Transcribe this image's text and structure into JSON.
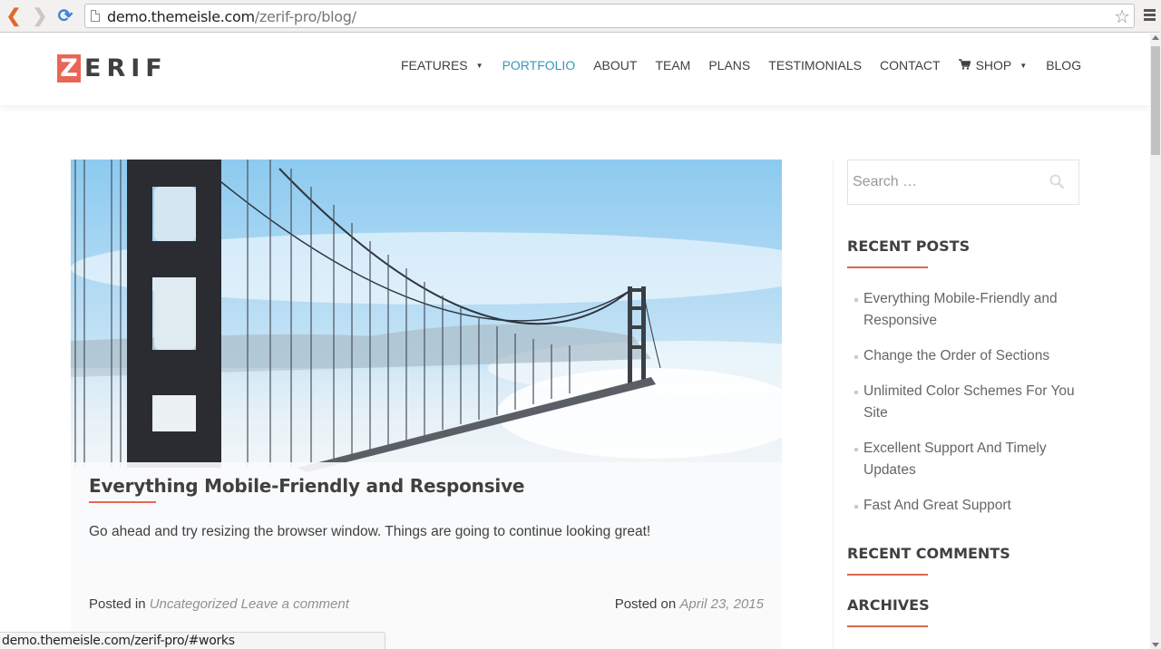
{
  "browser": {
    "url_domain": "demo.themeisle.com",
    "url_path": "/zerif-pro/blog/",
    "status_url": "demo.themeisle.com/zerif-pro/#works"
  },
  "site": {
    "logo_initial": "Z",
    "logo_rest": "ERIF",
    "accent_color": "#e96656",
    "active_nav_color": "#3498b8"
  },
  "nav": {
    "items": [
      {
        "label": "FEATURES",
        "has_dropdown": true
      },
      {
        "label": "PORTFOLIO",
        "active": true
      },
      {
        "label": "ABOUT"
      },
      {
        "label": "TEAM"
      },
      {
        "label": "PLANS"
      },
      {
        "label": "TESTIMONIALS"
      },
      {
        "label": "CONTACT"
      },
      {
        "label": "SHOP",
        "has_dropdown": true,
        "icon": "cart-icon"
      },
      {
        "label": "BLOG"
      }
    ]
  },
  "post": {
    "title": "Everything Mobile-Friendly and Responsive",
    "excerpt": "Go ahead and try resizing the browser window. Things are going to continue looking great!",
    "posted_in_label": "Posted in",
    "category": "Uncategorized",
    "comment_link": "Leave a comment",
    "posted_on_label": "Posted on",
    "date": "April 23, 2015",
    "image_alt": "Golden Gate Bridge in fog"
  },
  "sidebar": {
    "search_placeholder": "Search …",
    "recent_posts_title": "RECENT POSTS",
    "recent_posts": [
      "Everything Mobile-Friendly and Responsive",
      "Change the Order of Sections",
      "Unlimited Color Schemes For You Site",
      "Excellent Support And Timely Updates",
      "Fast And Great Support"
    ],
    "recent_comments_title": "RECENT COMMENTS",
    "archives_title": "ARCHIVES"
  }
}
